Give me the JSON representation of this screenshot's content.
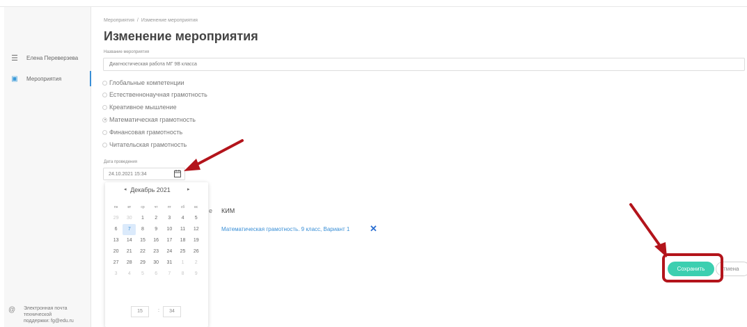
{
  "breadcrumb": {
    "parent": "Мероприятия",
    "separator": "/",
    "current": "Изменение мероприятия"
  },
  "page_title": "Изменение мероприятия",
  "sidebar": {
    "user_name": "Елена Переверзева",
    "items": [
      {
        "label": "Мероприятия",
        "active": true
      }
    ],
    "support_text": [
      "Электронная почта",
      "технической",
      "поддержки: fg@edu.ru"
    ]
  },
  "form": {
    "name_label": "Название мероприятия",
    "name_value": "Диагностическая работа МГ 9В класса",
    "categories": [
      {
        "label": "Глобальные компетенции",
        "checked": false
      },
      {
        "label": "Естественнонаучная грамотность",
        "checked": false
      },
      {
        "label": "Креативное мышление",
        "checked": false
      },
      {
        "label": "Математическая грамотность",
        "checked": true
      },
      {
        "label": "Финансовая грамотность",
        "checked": false
      },
      {
        "label": "Читательская грамотность",
        "checked": false
      }
    ],
    "date_label": "Дата проведения",
    "date_value": "24.10.2021 15:34"
  },
  "calendar": {
    "month_label": "Декабрь 2021",
    "prev": "◂",
    "next": "▸",
    "weekdays": [
      "пн",
      "вт",
      "ср",
      "чт",
      "пт",
      "сб",
      "вс"
    ],
    "weeks": [
      [
        "29",
        "30",
        "1",
        "2",
        "3",
        "4",
        "5"
      ],
      [
        "6",
        "7",
        "8",
        "9",
        "10",
        "11",
        "12"
      ],
      [
        "13",
        "14",
        "15",
        "16",
        "17",
        "18",
        "19"
      ],
      [
        "20",
        "21",
        "22",
        "23",
        "24",
        "25",
        "26"
      ],
      [
        "27",
        "28",
        "29",
        "30",
        "31",
        "1",
        "2"
      ],
      [
        "3",
        "4",
        "5",
        "6",
        "7",
        "8",
        "9"
      ]
    ],
    "hour": "15",
    "time_separator": ":",
    "minute": "34"
  },
  "table": {
    "partial_header": "е",
    "kim_header": "КИМ",
    "kim_item": "Математическая грамотность. 9 класс, Вариант 1"
  },
  "buttons": {
    "save": "Сохранить",
    "cancel": "тмена"
  },
  "colors": {
    "accent": "#3ccfb0",
    "link": "#3a8fd6",
    "annotation": "#b3141b"
  }
}
